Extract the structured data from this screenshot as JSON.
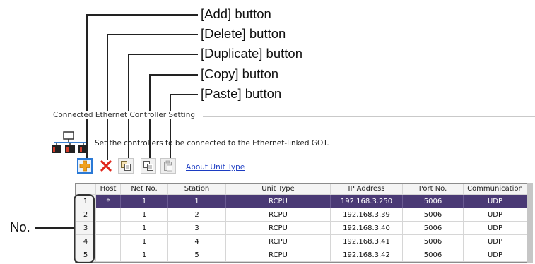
{
  "annotations": {
    "add": "[Add] button",
    "delete": "[Delete] button",
    "duplicate": "[Duplicate] button",
    "copy": "[Copy] button",
    "paste": "[Paste] button",
    "no": "No."
  },
  "panel": {
    "group_title": "Connected Ethernet Controller Setting",
    "description": "Set the controllers to be connected to the Ethernet-linked GOT.",
    "about_link": "About Unit Type"
  },
  "toolbar": {
    "icons": [
      "add-icon",
      "delete-icon",
      "duplicate-icon",
      "copy-icon",
      "paste-icon"
    ]
  },
  "table": {
    "headers": [
      "Host",
      "Net No.",
      "Station",
      "Unit Type",
      "IP Address",
      "Port No.",
      "Communication"
    ],
    "rows": [
      {
        "no": "1",
        "host": "*",
        "net_no": "1",
        "station": "1",
        "unit_type": "RCPU",
        "ip": "192.168.3.250",
        "port": "5006",
        "comm": "UDP"
      },
      {
        "no": "2",
        "host": "",
        "net_no": "1",
        "station": "2",
        "unit_type": "RCPU",
        "ip": "192.168.3.39",
        "port": "5006",
        "comm": "UDP"
      },
      {
        "no": "3",
        "host": "",
        "net_no": "1",
        "station": "3",
        "unit_type": "RCPU",
        "ip": "192.168.3.40",
        "port": "5006",
        "comm": "UDP"
      },
      {
        "no": "4",
        "host": "",
        "net_no": "1",
        "station": "4",
        "unit_type": "RCPU",
        "ip": "192.168.3.41",
        "port": "5006",
        "comm": "UDP"
      },
      {
        "no": "5",
        "host": "",
        "net_no": "1",
        "station": "5",
        "unit_type": "RCPU",
        "ip": "192.168.3.42",
        "port": "5006",
        "comm": "UDP"
      }
    ],
    "selected_row": 1
  },
  "colors": {
    "selection": "#4a3a75",
    "link": "#1c3cc2",
    "add_orange": "#f0a01e",
    "delete_red": "#e0261b"
  }
}
